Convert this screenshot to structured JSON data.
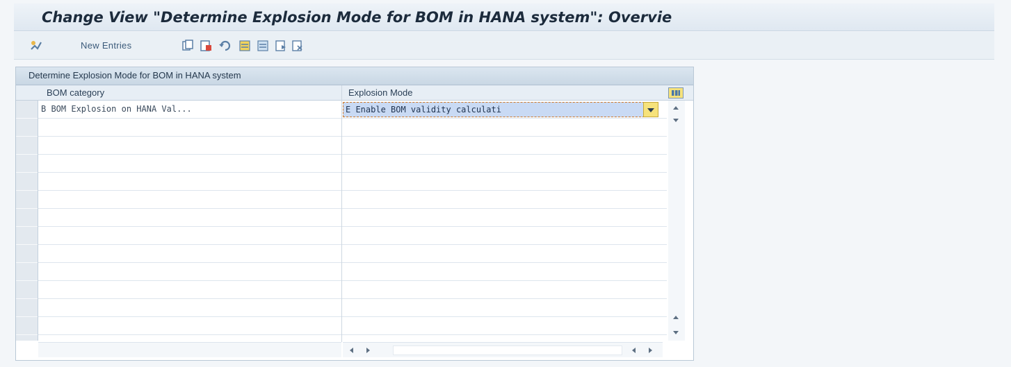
{
  "title": "Change View \"Determine Explosion Mode for BOM in HANA system\": Overvie",
  "toolbar": {
    "new_entries_label": "New Entries",
    "icons": [
      "display-change-icon",
      "copy-icon",
      "copy-as-icon",
      "undo-icon",
      "select-all-icon",
      "deselect-all-icon",
      "select-block-icon",
      "deselect-block-icon"
    ]
  },
  "table": {
    "title": "Determine Explosion Mode for BOM in HANA system",
    "columns": [
      "BOM category",
      "Explosion Mode"
    ],
    "rows": [
      {
        "bom_category": "B BOM Explosion on HANA Val...",
        "explosion_mode": "E Enable BOM validity calculati"
      }
    ]
  },
  "colors": {
    "title_text": "#1c2b3c",
    "selected_cell": "#c9daf4",
    "accent_yellow": "#f6e27b"
  }
}
